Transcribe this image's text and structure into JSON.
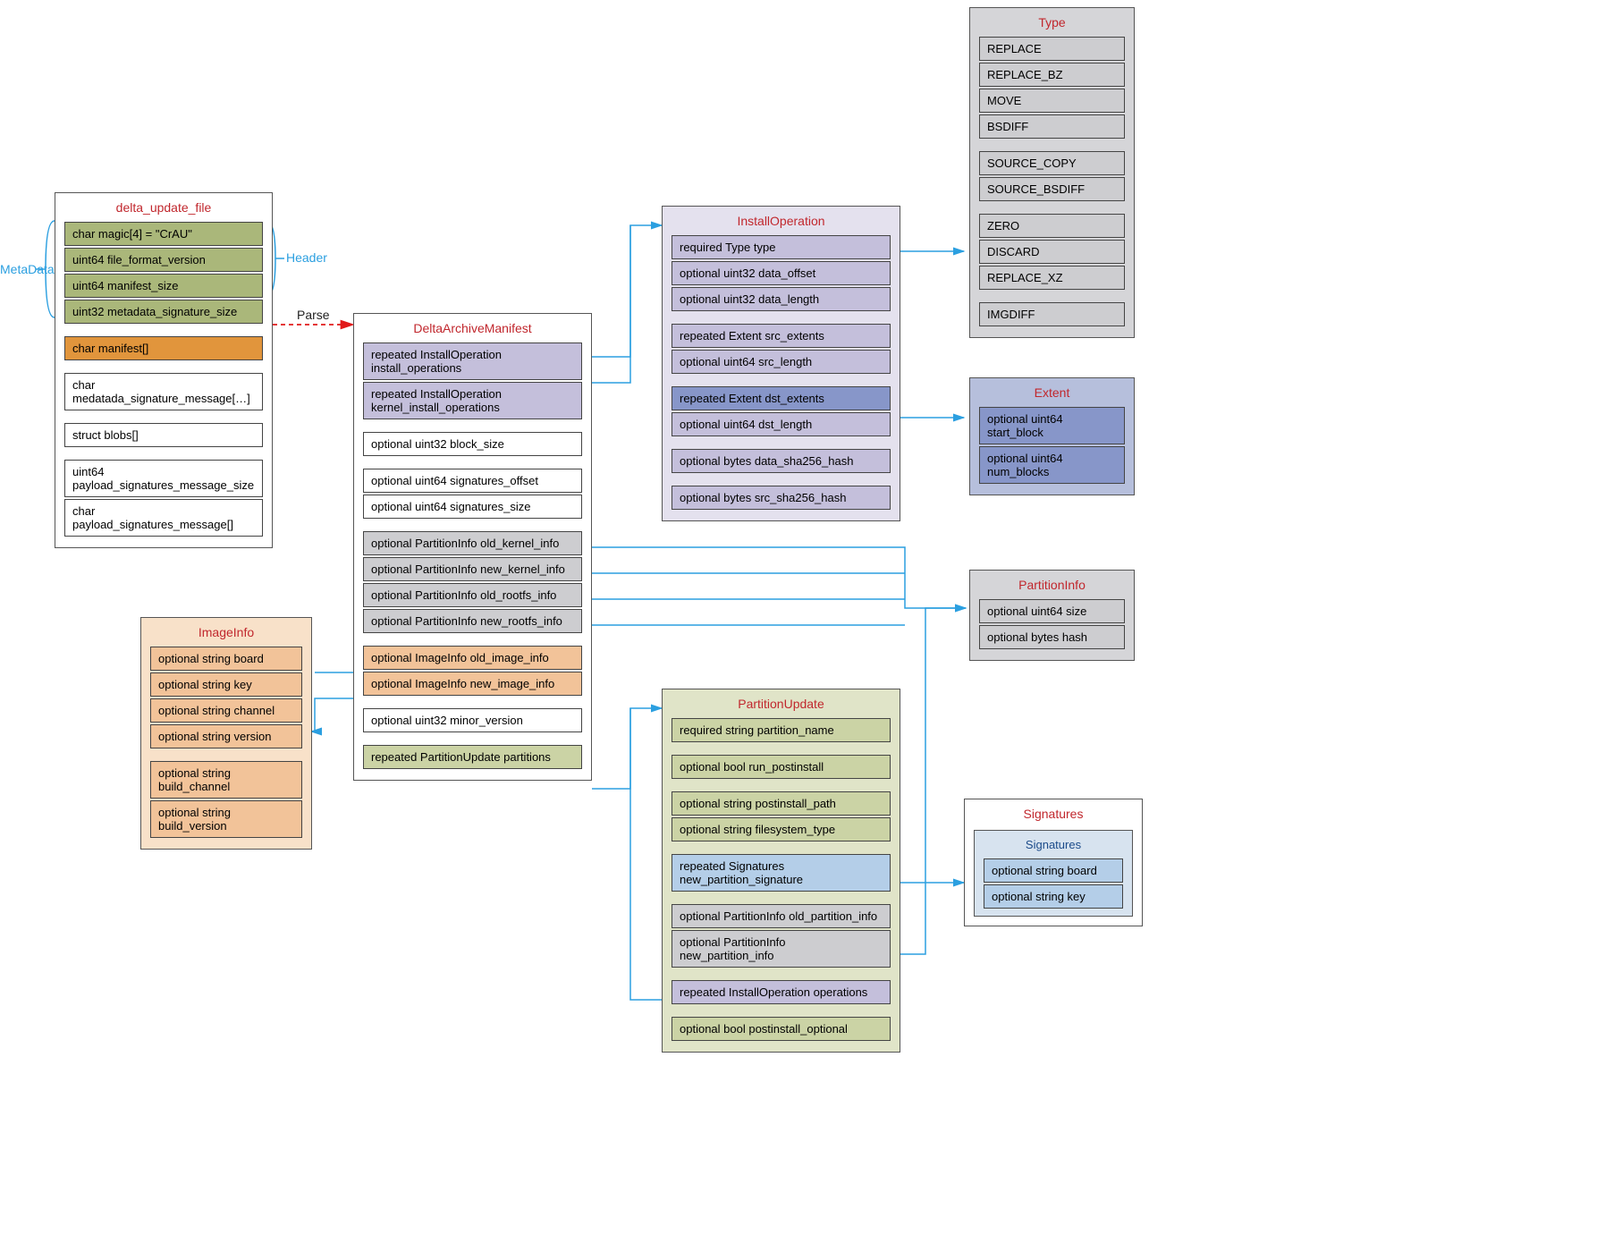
{
  "labels": {
    "metadata": "MetaData",
    "header": "Header",
    "parse": "Parse"
  },
  "delta_update_file": {
    "title": "delta_update_file",
    "magic": "char magic[4] = \"CrAU\"",
    "file_format_version": "uint64 file_format_version",
    "manifest_size": "uint64 manifest_size",
    "metadata_signature_size": "uint32 metadata_signature_size",
    "manifest": "char manifest[]",
    "metadata_signature_message": "char medatada_signature_message[…]",
    "struct_blobs": "struct blobs[]",
    "payload_signatures_message_size": "uint64 payload_signatures_message_size",
    "payload_signatures_message": "char payload_signatures_message[]"
  },
  "delta_archive_manifest": {
    "title": "DeltaArchiveManifest",
    "install_operations": "repeated InstallOperation install_operations",
    "kernel_install_operations": "repeated InstallOperation kernel_install_operations",
    "block_size": "optional uint32 block_size",
    "signatures_offset": "optional uint64 signatures_offset",
    "signatures_size": "optional uint64 signatures_size",
    "old_kernel_info": "optional PartitionInfo old_kernel_info",
    "new_kernel_info": "optional PartitionInfo new_kernel_info",
    "old_rootfs_info": "optional PartitionInfo old_rootfs_info",
    "new_rootfs_info": "optional PartitionInfo new_rootfs_info",
    "old_image_info": "optional ImageInfo old_image_info",
    "new_image_info": "optional ImageInfo new_image_info",
    "minor_version": "optional uint32 minor_version",
    "partitions": "repeated PartitionUpdate partitions"
  },
  "install_operation": {
    "title": "InstallOperation",
    "type": "required Type type",
    "data_offset": "optional uint32 data_offset",
    "data_length": "optional uint32 data_length",
    "src_extents": "repeated Extent src_extents",
    "src_length": "optional uint64 src_length",
    "dst_extents": "repeated Extent dst_extents",
    "dst_length": "optional uint64 dst_length",
    "data_sha256_hash": "optional bytes data_sha256_hash",
    "src_sha256_hash": "optional bytes src_sha256_hash"
  },
  "type_enum": {
    "title": "Type",
    "v0": "REPLACE",
    "v1": "REPLACE_BZ",
    "v2": "MOVE",
    "v3": "BSDIFF",
    "v4": "SOURCE_COPY",
    "v5": "SOURCE_BSDIFF",
    "v6": "ZERO",
    "v7": "DISCARD",
    "v8": "REPLACE_XZ",
    "v9": "IMGDIFF"
  },
  "extent": {
    "title": "Extent",
    "start_block": "optional uint64 start_block",
    "num_blocks": "optional uint64 num_blocks"
  },
  "partition_info": {
    "title": "PartitionInfo",
    "size": "optional uint64 size",
    "hash": "optional bytes hash"
  },
  "signatures": {
    "title": "Signatures",
    "inner_title": "Signatures",
    "board": "optional string board",
    "key": "optional string key"
  },
  "image_info": {
    "title": "ImageInfo",
    "board": "optional string board",
    "key": "optional string key",
    "channel": "optional string channel",
    "version": "optional string version",
    "build_channel": "optional string build_channel",
    "build_version": "optional string build_version"
  },
  "partition_update": {
    "title": "PartitionUpdate",
    "partition_name": "required string partition_name",
    "run_postinstall": "optional bool run_postinstall",
    "postinstall_path": "optional string postinstall_path",
    "filesystem_type": "optional string filesystem_type",
    "new_partition_signature": "repeated Signatures  new_partition_signature",
    "old_partition_info": "optional PartitionInfo old_partition_info",
    "new_partition_info": "optional PartitionInfo new_partition_info",
    "operations": "repeated InstallOperation operations",
    "postinstall_optional": "optional bool postinstall_optional"
  },
  "colors": {
    "title_red": "#c1272d",
    "arrow_blue": "#2b9fe0",
    "arrow_red": "#e11919"
  }
}
